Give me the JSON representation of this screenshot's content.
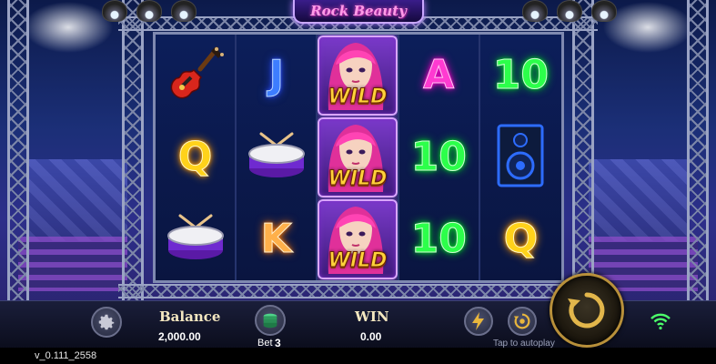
{
  "game": {
    "title": "Rock Beauty"
  },
  "reels": [
    [
      {
        "symbol": "guitar-icon",
        "type": "image"
      },
      {
        "symbol": "Q",
        "type": "letter",
        "color": "#ffd21a"
      },
      {
        "symbol": "drum-icon",
        "type": "image"
      }
    ],
    [
      {
        "symbol": "J",
        "type": "letter",
        "color": "#3d7dff"
      },
      {
        "symbol": "drum-icon",
        "type": "image"
      },
      {
        "symbol": "K",
        "type": "letter",
        "color": "#ffb04a"
      }
    ],
    [
      {
        "symbol": "WILD",
        "type": "wild"
      },
      {
        "symbol": "WILD",
        "type": "wild"
      },
      {
        "symbol": "WILD",
        "type": "wild"
      }
    ],
    [
      {
        "symbol": "A",
        "type": "letter",
        "color": "#ff3ad1"
      },
      {
        "symbol": "10",
        "type": "letter",
        "color": "#2cff4a"
      },
      {
        "symbol": "10",
        "type": "letter",
        "color": "#2cff4a"
      }
    ],
    [
      {
        "symbol": "10",
        "type": "letter",
        "color": "#2cff4a"
      },
      {
        "symbol": "speaker-icon",
        "type": "image"
      },
      {
        "symbol": "Q",
        "type": "letter",
        "color": "#ffd21a"
      }
    ]
  ],
  "hud": {
    "balance_label": "Balance",
    "balance_value": "2,000.00",
    "bet_label": "Bet",
    "bet_value": "3",
    "win_label": "WIN",
    "win_value": "0.00",
    "autoplay_hint": "Tap to autoplay",
    "icons": [
      "gear-icon",
      "coin-stack-icon",
      "lightning-icon",
      "autoplay-icon",
      "spin-icon",
      "wifi-icon"
    ]
  },
  "version": "v_0.111_2558",
  "colors": {
    "accent": "#b8903a",
    "title_glow": "#ff4fd2"
  }
}
